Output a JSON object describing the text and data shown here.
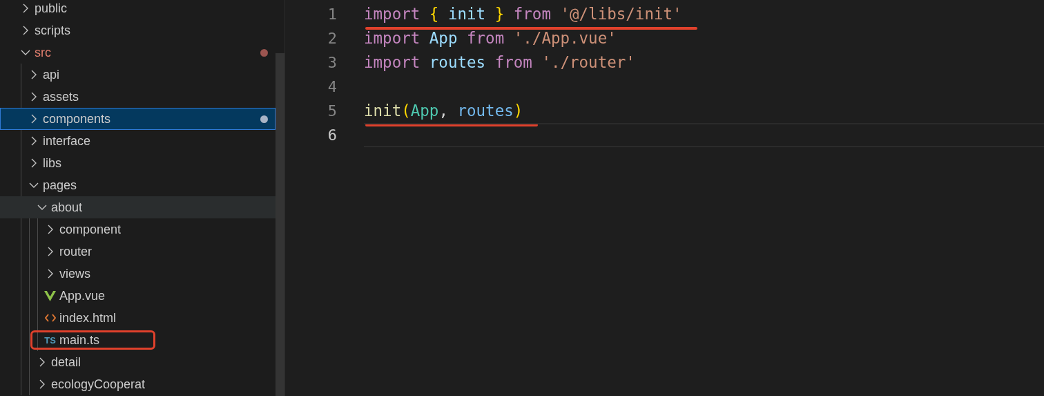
{
  "explorer": {
    "items": [
      {
        "label": "public",
        "kind": "folder",
        "expanded": false,
        "selected": false
      },
      {
        "label": "scripts",
        "kind": "folder",
        "expanded": false,
        "selected": false
      },
      {
        "label": "src",
        "kind": "folder",
        "expanded": true,
        "selected": false,
        "error": true,
        "modified": true,
        "children": [
          {
            "label": "api",
            "kind": "folder",
            "expanded": false,
            "selected": false
          },
          {
            "label": "assets",
            "kind": "folder",
            "expanded": false,
            "selected": false
          },
          {
            "label": "components",
            "kind": "folder",
            "expanded": false,
            "selected": true,
            "modified": true
          },
          {
            "label": "interface",
            "kind": "folder",
            "expanded": false,
            "selected": false
          },
          {
            "label": "libs",
            "kind": "folder",
            "expanded": false,
            "selected": false
          },
          {
            "label": "pages",
            "kind": "folder",
            "expanded": true,
            "selected": false,
            "children": [
              {
                "label": "about",
                "kind": "folder",
                "expanded": true,
                "selected": false,
                "hovered": true,
                "children": [
                  {
                    "label": "component",
                    "kind": "folder",
                    "expanded": false,
                    "selected": false
                  },
                  {
                    "label": "router",
                    "kind": "folder",
                    "expanded": false,
                    "selected": false
                  },
                  {
                    "label": "views",
                    "kind": "folder",
                    "expanded": false,
                    "selected": false
                  },
                  {
                    "label": "App.vue",
                    "kind": "vue",
                    "selected": false
                  },
                  {
                    "label": "index.html",
                    "kind": "html",
                    "selected": false
                  },
                  {
                    "label": "main.ts",
                    "kind": "ts",
                    "badge": "TS",
                    "selected": false,
                    "highlighted": true
                  }
                ]
              },
              {
                "label": "detail",
                "kind": "folder",
                "expanded": false,
                "selected": false
              },
              {
                "label": "ecologyCooperat",
                "kind": "folder",
                "expanded": false,
                "selected": false
              }
            ]
          }
        ]
      }
    ]
  },
  "editor": {
    "lines": [
      {
        "number": "1",
        "underlined": true,
        "current": false,
        "tokens": [
          {
            "text": "import ",
            "kind": "keyword"
          },
          {
            "text": "{",
            "kind": "brace"
          },
          {
            "text": " init ",
            "kind": "variable"
          },
          {
            "text": "} ",
            "kind": "brace"
          },
          {
            "text": "from ",
            "kind": "keyword"
          },
          {
            "text": "'@/libs/init'",
            "kind": "string"
          }
        ]
      },
      {
        "number": "2",
        "underlined": false,
        "current": false,
        "tokens": [
          {
            "text": "import ",
            "kind": "keyword"
          },
          {
            "text": "App ",
            "kind": "variable"
          },
          {
            "text": "from ",
            "kind": "keyword"
          },
          {
            "text": "'./App.vue'",
            "kind": "string"
          }
        ]
      },
      {
        "number": "3",
        "underlined": false,
        "current": false,
        "tokens": [
          {
            "text": "import ",
            "kind": "keyword"
          },
          {
            "text": "routes ",
            "kind": "variable"
          },
          {
            "text": "from ",
            "kind": "keyword"
          },
          {
            "text": "'./router'",
            "kind": "string"
          }
        ]
      },
      {
        "number": "4",
        "underlined": false,
        "current": false
      },
      {
        "number": "5",
        "underlined": true,
        "current": false,
        "tokens": [
          {
            "text": "init",
            "kind": "function"
          },
          {
            "text": "(",
            "kind": "brace"
          },
          {
            "text": "App",
            "kind": "class"
          },
          {
            "text": ", ",
            "kind": "plain"
          },
          {
            "text": "routes",
            "kind": "param"
          },
          {
            "text": ")",
            "kind": "brace"
          }
        ]
      },
      {
        "number": "6",
        "underlined": false,
        "current": true
      }
    ]
  }
}
